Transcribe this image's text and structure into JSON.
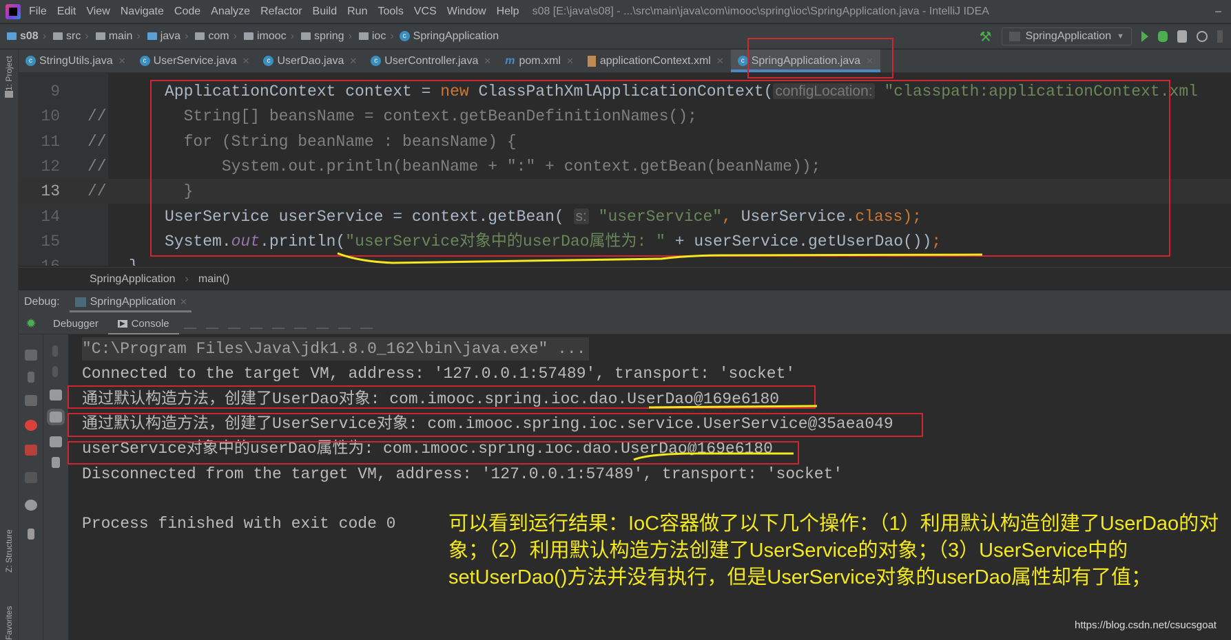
{
  "menubar": {
    "items": [
      "File",
      "Edit",
      "View",
      "Navigate",
      "Code",
      "Analyze",
      "Refactor",
      "Build",
      "Run",
      "Tools",
      "VCS",
      "Window",
      "Help"
    ],
    "title": "s08 [E:\\java\\s08] - ...\\src\\main\\java\\com\\imooc\\spring\\ioc\\SpringApplication.java - IntelliJ IDEA",
    "minimize": "–"
  },
  "navbar": {
    "crumbs": [
      "s08",
      "src",
      "main",
      "java",
      "com",
      "imooc",
      "spring",
      "ioc",
      "SpringApplication"
    ],
    "run_config": "SpringApplication"
  },
  "tabs": [
    {
      "label": "StringUtils.java",
      "icon": "class-icon"
    },
    {
      "label": "UserService.java",
      "icon": "class-icon"
    },
    {
      "label": "UserDao.java",
      "icon": "class-icon"
    },
    {
      "label": "UserController.java",
      "icon": "class-icon"
    },
    {
      "label": "pom.xml",
      "icon": "maven-icon"
    },
    {
      "label": "applicationContext.xml",
      "icon": "xml-icon"
    },
    {
      "label": "SpringApplication.java",
      "icon": "class-icon",
      "active": true
    }
  ],
  "sidebar": {
    "project": "1: Project",
    "structure": "Z: Structure",
    "favorites": "Favorites"
  },
  "editor": {
    "lines": [
      {
        "num": "9",
        "marker": "",
        "tokens": [
          {
            "t": "ApplicationContext context = ",
            "k": "plain"
          },
          {
            "t": "new",
            "k": "keyword"
          },
          {
            "t": " ClassPathXmlApplicationContext(",
            "k": "plain"
          },
          {
            "t": "configLocation:",
            "k": "hint"
          },
          {
            "t": " \"classpath:applicationContext.xml",
            "k": "string"
          }
        ]
      },
      {
        "num": "10",
        "marker": "//",
        "tokens": [
          {
            "t": "  String[] beansName = context.getBeanDefinitionNames();",
            "k": "comment"
          }
        ]
      },
      {
        "num": "11",
        "marker": "//",
        "tokens": [
          {
            "t": "  for (String beanName : beansName) {",
            "k": "comment"
          }
        ]
      },
      {
        "num": "12",
        "marker": "//",
        "tokens": [
          {
            "t": "      System.out.println(beanName + \":\" + context.getBean(beanName));",
            "k": "comment"
          }
        ]
      },
      {
        "num": "13",
        "marker": "//",
        "current": true,
        "tokens": [
          {
            "t": "  }",
            "k": "comment"
          }
        ]
      },
      {
        "num": "14",
        "marker": "",
        "tokens": [
          {
            "t": "UserService userService = context.getBean( ",
            "k": "plain"
          },
          {
            "t": "s:",
            "k": "hint"
          },
          {
            "t": " \"userService\"",
            "k": "string"
          },
          {
            "t": ", ",
            "k": "keyword"
          },
          {
            "t": "UserService.",
            "k": "plain"
          },
          {
            "t": "class",
            "k": "keyword"
          },
          {
            "t": ");",
            "k": "keyword"
          }
        ]
      },
      {
        "num": "15",
        "marker": "",
        "tokens": [
          {
            "t": "System.",
            "k": "plain"
          },
          {
            "t": "out",
            "k": "static"
          },
          {
            "t": ".println(",
            "k": "plain"
          },
          {
            "t": "\"userService对象中的userDao属性为: \"",
            "k": "string"
          },
          {
            "t": " + userService.getUserDao())",
            "k": "plain"
          },
          {
            "t": ";",
            "k": "keyword"
          }
        ]
      },
      {
        "num": "16",
        "marker": "",
        "tokens": [
          {
            "t": "}",
            "k": "plain"
          }
        ]
      }
    ]
  },
  "breadcrumb": [
    "SpringApplication",
    "main()"
  ],
  "debug": {
    "label": "Debug:",
    "session": "SpringApplication",
    "tabs": [
      "Debugger",
      "Console"
    ]
  },
  "console": {
    "lines": [
      "\"C:\\Program Files\\Java\\jdk1.8.0_162\\bin\\java.exe\" ...",
      "Connected to the target VM, address: '127.0.0.1:57489', transport: 'socket'",
      "通过默认构造方法，创建了UserDao对象: com.imooc.spring.ioc.dao.UserDao@169e6180",
      "通过默认构造方法，创建了UserService对象: com.imooc.spring.ioc.service.UserService@35aea049",
      "userService对象中的userDao属性为: com.imooc.spring.ioc.dao.UserDao@169e6180",
      "Disconnected from the target VM, address: '127.0.0.1:57489', transport: 'socket'",
      "",
      "Process finished with exit code 0"
    ]
  },
  "annotation": "可以看到运行结果：IoC容器做了以下几个操作：（1）利用默认构造创建了UserDao的对象；（2）利用默认构造方法创建了UserService的对象；（3）UserService中的setUserDao()方法并没有执行，但是UserService对象的userDao属性却有了值；",
  "watermark": "https://blog.csdn.net/csucsgoat",
  "colors": {
    "highlight_box": "#d1262e",
    "underline": "#f4e91f",
    "annotation": "#f4e91f",
    "keyword": "#cc7832",
    "string": "#6a8759"
  }
}
